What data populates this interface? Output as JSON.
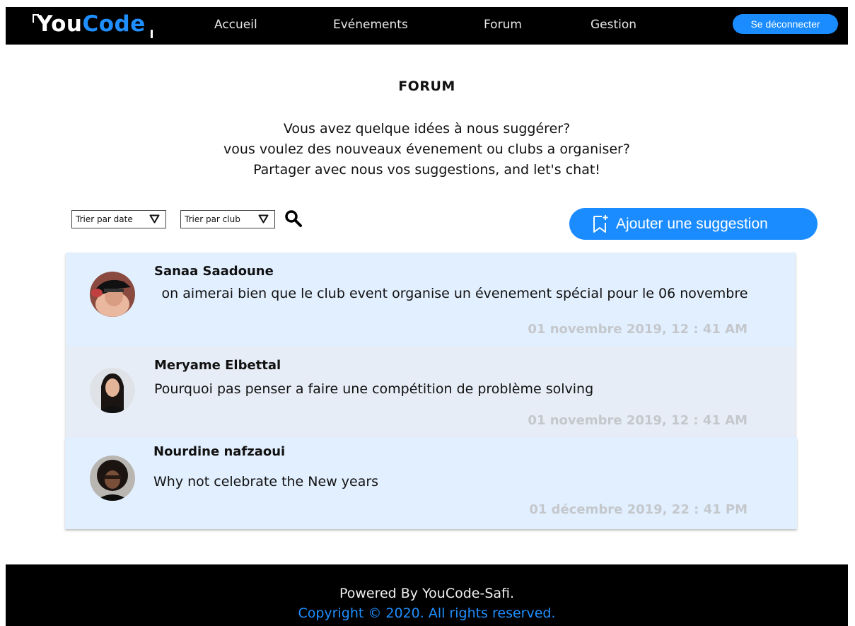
{
  "nav": {
    "logo_left": "You",
    "logo_right": "Code",
    "links": [
      "Accueil",
      "Evénements",
      "Forum",
      "Gestion"
    ],
    "logout_label": "Se déconnecter"
  },
  "forum": {
    "title": "FORUM",
    "intro": [
      "Vous avez quelque idées à nous suggérer?",
      "vous voulez des nouveaux évenement ou clubs a organiser?",
      "Partager avec nous vos suggestions, and let's chat!"
    ],
    "filters": {
      "sort_date": "Trier par date",
      "sort_club": "Trier par club"
    },
    "add_label": "Ajouter une suggestion"
  },
  "suggestions": [
    {
      "author": "Sanaa Saadoune",
      "message": "on aimerai bien que le club event organise un évenement spécial pour le 06 novembre",
      "date": "01 novembre 2019, 12 : 41 AM"
    },
    {
      "author": "Meryame Elbettal",
      "message": "Pourquoi pas penser a faire une compétition de problème solving",
      "date": "01 novembre 2019, 12 : 41 AM"
    },
    {
      "author": "Nourdine nafzaoui",
      "message": "Why not celebrate the New years",
      "date": "01 décembre 2019, 22 : 41 PM"
    }
  ],
  "footer": {
    "powered": "Powered By YouCode-Safi.",
    "copyright": "Copyright © 2020. All rights reserved."
  },
  "colors": {
    "brand_blue": "#1a8cff",
    "card_bg": "#e2efff",
    "card_bg_alt": "#e7edf6",
    "timestamp": "#c4c8cc"
  }
}
